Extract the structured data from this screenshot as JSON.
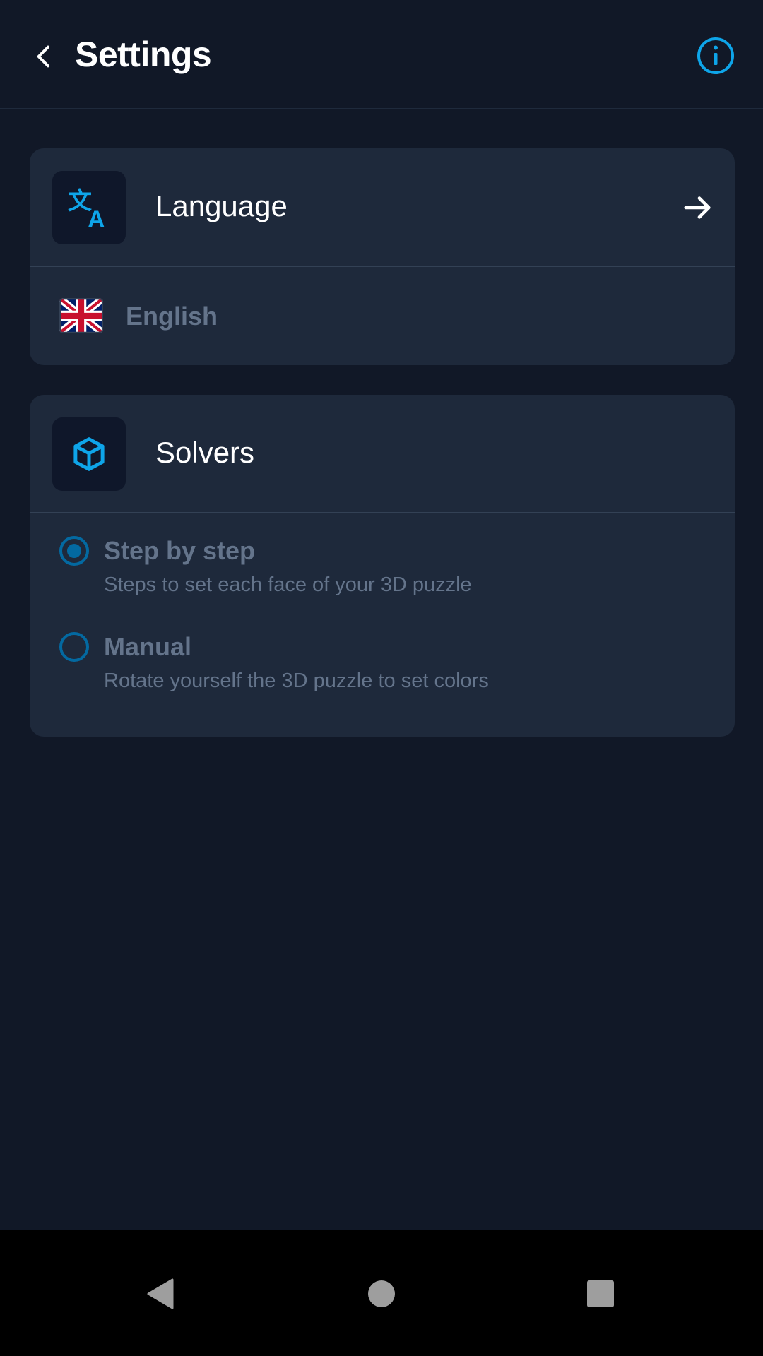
{
  "header": {
    "title": "Settings",
    "back_icon": "chevron-left-icon",
    "info_icon": "info-circle-icon"
  },
  "language_card": {
    "title": "Language",
    "icon": "translate-icon",
    "action_icon": "arrow-right-icon",
    "current_language": "English",
    "flag_icon": "uk-flag-icon"
  },
  "solvers_card": {
    "title": "Solvers",
    "icon": "cube-icon",
    "options": [
      {
        "title": "Step by step",
        "description": "Steps to set each face of your 3D puzzle",
        "selected": true
      },
      {
        "title": "Manual",
        "description": "Rotate yourself the 3D puzzle to set colors",
        "selected": false
      }
    ]
  },
  "colors": {
    "background": "#111827",
    "card": "#1e293b",
    "accent": "#0ea5e9",
    "radio": "#0369a1",
    "muted_text": "#64748b"
  },
  "navbar": {
    "icons": [
      "nav-back-icon",
      "nav-home-icon",
      "nav-recents-icon"
    ]
  }
}
